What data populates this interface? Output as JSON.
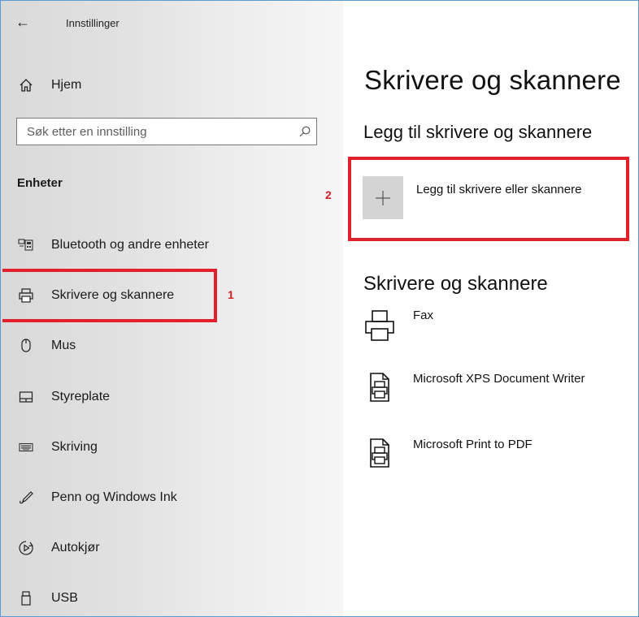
{
  "window": {
    "title": "Innstillinger",
    "back_glyph": "←"
  },
  "sidebar": {
    "home_label": "Hjem",
    "search_placeholder": "Søk etter en innstilling",
    "section": "Enheter",
    "items": [
      {
        "label": "Bluetooth og andre enheter",
        "icon": "bluetooth-devices-icon"
      },
      {
        "label": "Skrivere og skannere",
        "icon": "printer-icon",
        "selected": true
      },
      {
        "label": "Mus",
        "icon": "mouse-icon"
      },
      {
        "label": "Styreplate",
        "icon": "touchpad-icon"
      },
      {
        "label": "Skriving",
        "icon": "keyboard-icon"
      },
      {
        "label": "Penn og Windows Ink",
        "icon": "pen-icon"
      },
      {
        "label": "Autokjør",
        "icon": "autoplay-icon"
      },
      {
        "label": "USB",
        "icon": "usb-icon"
      }
    ]
  },
  "main": {
    "title": "Skrivere og skannere",
    "add_section_title": "Legg til skrivere og skannere",
    "add_button_label": "Legg til skrivere eller skannere",
    "list_title": "Skrivere og skannere",
    "printers": [
      {
        "name": "Fax",
        "icon": "fax-printer-icon"
      },
      {
        "name": "Microsoft XPS Document Writer",
        "icon": "document-printer-icon"
      },
      {
        "name": "Microsoft Print to PDF",
        "icon": "document-printer-icon"
      }
    ]
  },
  "annotations": {
    "marker_1": "1",
    "marker_2": "2",
    "color": "#e0202b"
  }
}
